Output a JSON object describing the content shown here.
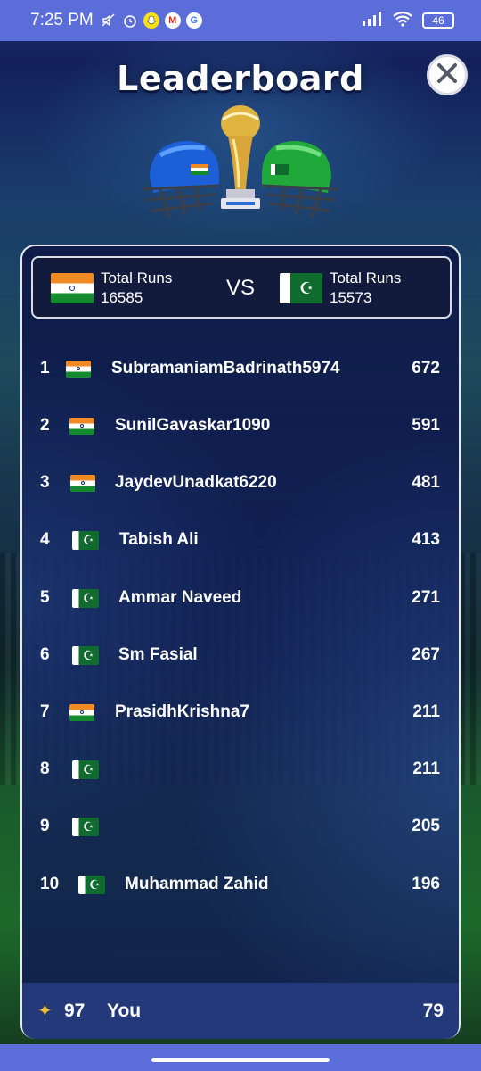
{
  "status_bar": {
    "time": "7:25 PM",
    "notification_icons": [
      "mute-icon",
      "alarm-icon",
      "snapchat-icon",
      "gmail-icon",
      "google-icon"
    ],
    "signal": "signal-icon",
    "wifi": "wifi-icon",
    "battery": "46"
  },
  "header": {
    "title": "Leaderboard",
    "close_icon": "close-icon"
  },
  "team_totals": {
    "left": {
      "flag": "india-flag",
      "label": "Total Runs",
      "value": "16585"
    },
    "vs": "VS",
    "right": {
      "flag": "pakistan-flag",
      "label": "Total Runs",
      "value": "15573"
    }
  },
  "leaderboard": [
    {
      "rank": "1",
      "flag": "india",
      "name": "SubramaniamBadrinath5974",
      "score": "672"
    },
    {
      "rank": "2",
      "flag": "india",
      "name": "SunilGavaskar1090",
      "score": "591"
    },
    {
      "rank": "3",
      "flag": "india",
      "name": "JaydevUnadkat6220",
      "score": "481"
    },
    {
      "rank": "4",
      "flag": "pakistan",
      "name": "Tabish Ali",
      "score": "413"
    },
    {
      "rank": "5",
      "flag": "pakistan",
      "name": "Ammar Naveed",
      "score": "271"
    },
    {
      "rank": "6",
      "flag": "pakistan",
      "name": "Sm Fasial",
      "score": "267"
    },
    {
      "rank": "7",
      "flag": "india",
      "name": "PrasidhKrishna7",
      "score": "211"
    },
    {
      "rank": "8",
      "flag": "pakistan",
      "name": "",
      "score": "211"
    },
    {
      "rank": "9",
      "flag": "pakistan",
      "name": "",
      "score": "205"
    },
    {
      "rank": "10",
      "flag": "pakistan",
      "name": "Muhammad Zahid",
      "score": "196"
    }
  ],
  "current_user": {
    "icon": "star-icon",
    "rank": "97",
    "name": "You",
    "score": "79"
  },
  "colors": {
    "status_bar": "#5b6dd8",
    "panel": "#10204f",
    "you_bar": "#24397a",
    "star": "#f2c233",
    "india_saffron": "#f08a24",
    "india_green": "#138a2e",
    "pakistan_green": "#0f6b2e"
  }
}
